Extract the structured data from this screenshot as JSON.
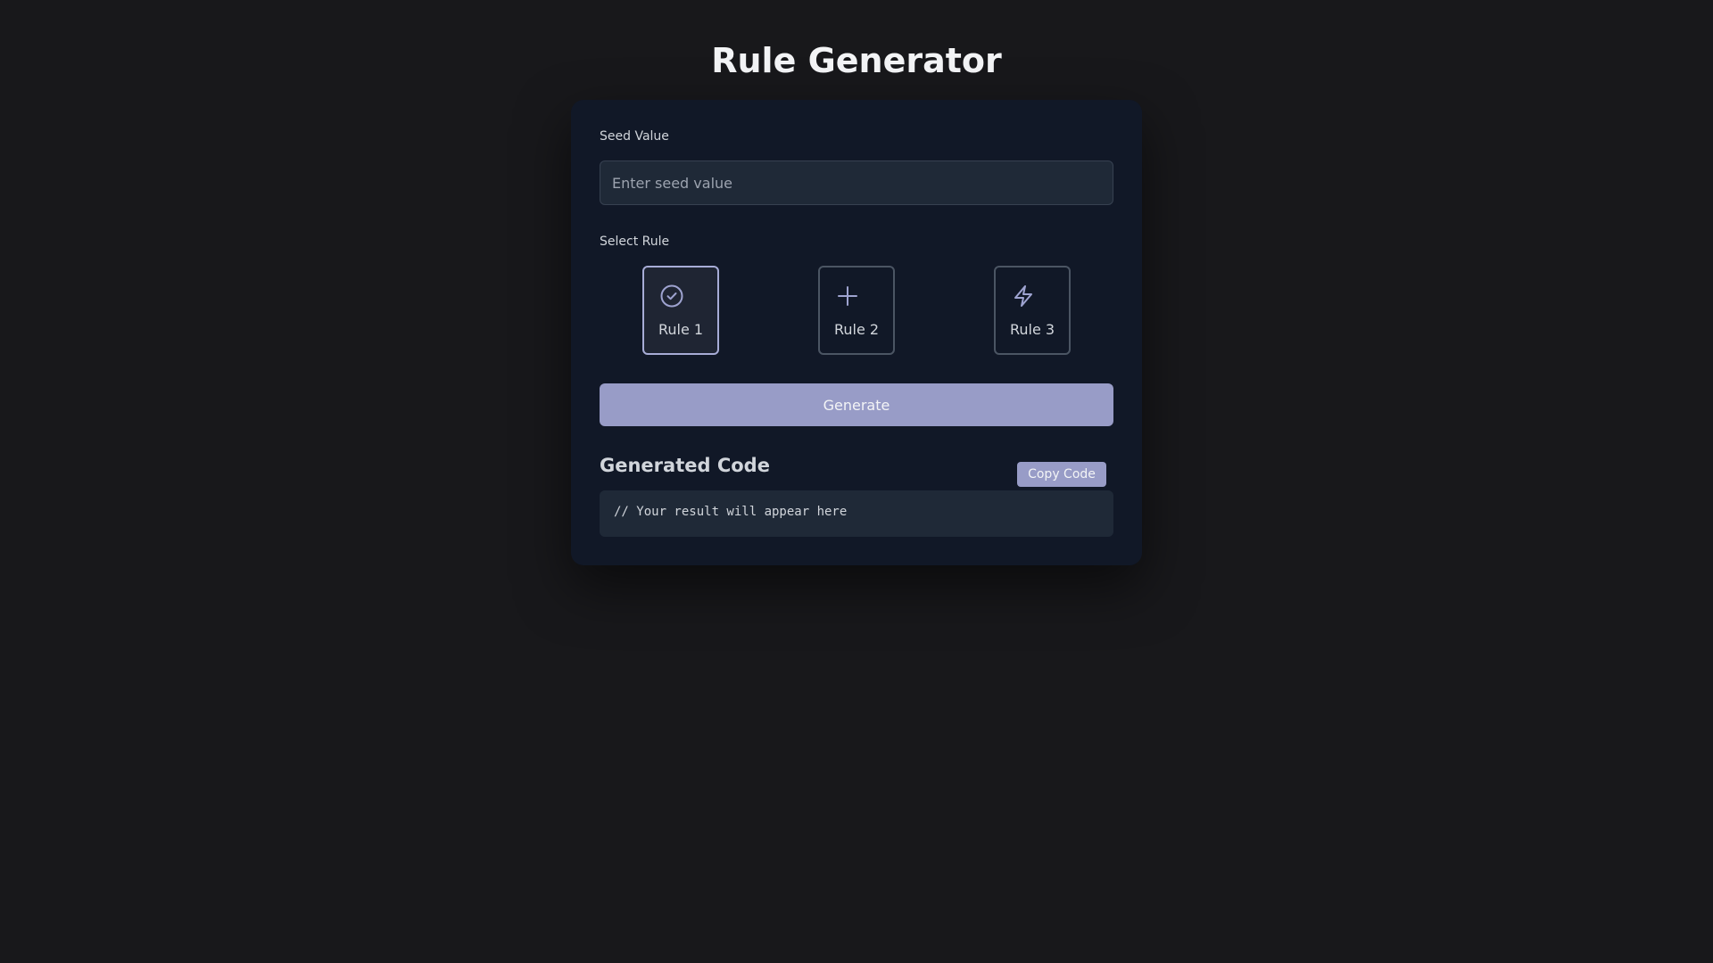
{
  "page": {
    "title": "Rule Generator"
  },
  "seed": {
    "label": "Seed Value",
    "placeholder": "Enter seed value",
    "value": ""
  },
  "rules": {
    "label": "Select Rule",
    "selected": "Rule 1",
    "options": [
      {
        "label": "Rule 1",
        "icon": "check-circle-icon"
      },
      {
        "label": "Rule 2",
        "icon": "plus-icon"
      },
      {
        "label": "Rule 3",
        "icon": "lightning-bolt-icon"
      }
    ]
  },
  "actions": {
    "generate_label": "Generate",
    "copy_label": "Copy Code"
  },
  "output": {
    "title": "Generated Code",
    "code": "// Your result will appear here"
  },
  "colors": {
    "background": "#18181b",
    "card": "#111827",
    "accent": "#989cc7"
  }
}
